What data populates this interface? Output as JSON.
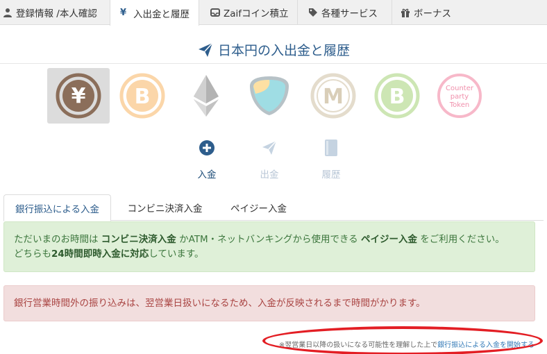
{
  "nav": {
    "tabs": [
      {
        "label": "登録情報 /本人確認",
        "icon": "user-icon"
      },
      {
        "label": "入出金と履歴",
        "icon": "yen-icon"
      },
      {
        "label": "Zaifコイン積立",
        "icon": "inbox-icon"
      },
      {
        "label": "各種サービス",
        "icon": "tags-icon"
      },
      {
        "label": "ボーナス",
        "icon": "gift-icon"
      }
    ],
    "active_index": 1
  },
  "page": {
    "title": "日本円の入出金と履歴",
    "title_icon": "paper-plane-icon"
  },
  "coins": [
    {
      "name": "jpy",
      "glyph": "¥",
      "color": "#8b6e5a",
      "selected": true
    },
    {
      "name": "btc",
      "glyph": "B",
      "color": "#f7a84a"
    },
    {
      "name": "eth",
      "glyph": "eth",
      "color": "#9a9a9a"
    },
    {
      "name": "xem",
      "glyph": "xem",
      "color": "#67b2c3"
    },
    {
      "name": "mona",
      "glyph": "M",
      "color": "#c8b693"
    },
    {
      "name": "bch",
      "glyph": "B",
      "color": "#8dc351"
    },
    {
      "name": "xcp",
      "glyph": "Counter party Token",
      "color": "#ee5d8b",
      "text": [
        "Counter",
        "party",
        "Token"
      ]
    }
  ],
  "actions": [
    {
      "label": "入金",
      "icon": "plus-circle-icon",
      "active": true
    },
    {
      "label": "出金",
      "icon": "paper-plane-icon",
      "active": false
    },
    {
      "label": "履歴",
      "icon": "book-icon",
      "active": false
    }
  ],
  "method_tabs": [
    {
      "label": "銀行振込による入金",
      "active": true
    },
    {
      "label": "コンビニ決済入金",
      "active": false
    },
    {
      "label": "ペイジー入金",
      "active": false
    }
  ],
  "alert_success": {
    "t1": "ただいまのお時間は ",
    "b1": "コンビニ決済入金",
    "t2": " かATM・ネットバンキングから使用できる ",
    "b2": "ペイジー入金",
    "t3": " をご利用ください。",
    "t4": "どちらも",
    "b3": "24時間即時入金に対応",
    "t5": "しています。"
  },
  "alert_danger": {
    "text": "銀行営業時間外の振り込みは、翌営業日扱いになるため、入金が反映されるまで時間がかります。"
  },
  "note": {
    "text": "※翌営業日以降の扱いになる可能性を理解した上で",
    "link": "銀行振込による入金を開始する"
  },
  "colors": {
    "primary": "#2d5d8c",
    "success_bg": "#dff0d8",
    "danger_bg": "#f2dede",
    "highlight": "#e31e24"
  }
}
